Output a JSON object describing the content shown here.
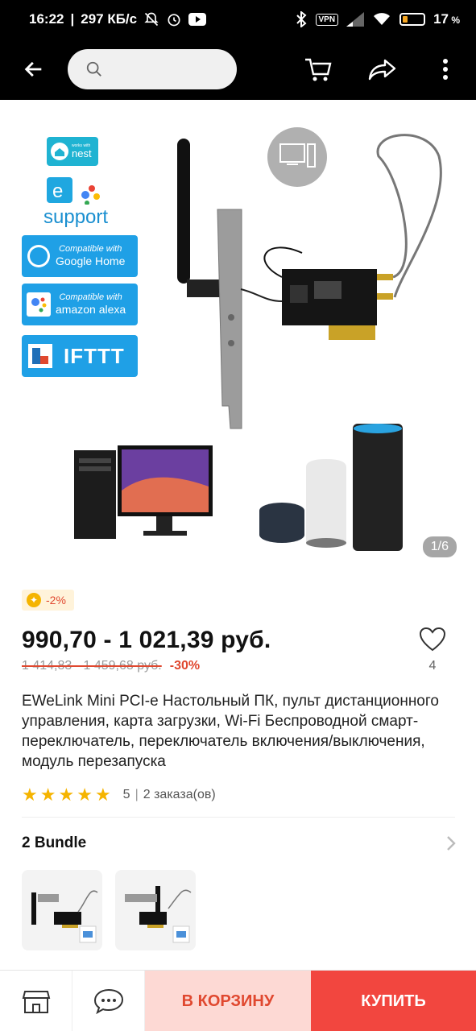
{
  "status_bar": {
    "time": "16:22",
    "speed": "297 КБ/с",
    "vpn": "VPN",
    "battery": "17"
  },
  "app_bar": {
    "search_placeholder": "",
    "icons": [
      "back-arrow-icon",
      "search-icon",
      "cart-icon",
      "share-icon",
      "more-icon"
    ]
  },
  "gallery": {
    "counter": "1/6",
    "badges": {
      "nest_top": "works with",
      "nest": "nest",
      "support": "support",
      "google_line1": "Compatible with",
      "google_line2": "Google Home",
      "alexa_line1": "Compatible with",
      "alexa_line2": "amazon alexa",
      "ifttt": "IFTTT"
    }
  },
  "product": {
    "discount_badge": "-2%",
    "price": "990,70 - 1 021,39 руб.",
    "old_price": "1 414,83 - 1 459,68 руб.",
    "discount_pct": "-30%",
    "favorites_count": "4",
    "title": "EWeLink Mini PCI-e Настольный ПК, пульт дистанционного управления, карта загрузки, Wi-Fi Беспроводной смарт-переключатель, переключатель включения/выключения, модуль перезапуска",
    "rating_value": "5",
    "orders": "2 заказа(ов)"
  },
  "bundle": {
    "label": "2 Bundle"
  },
  "bottom_bar": {
    "add_to_cart": "В КОРЗИНУ",
    "buy": "КУПИТЬ"
  },
  "colors": {
    "accent_red": "#f2463f",
    "cart_bg": "#fdd9d4",
    "star": "#f5b400"
  }
}
